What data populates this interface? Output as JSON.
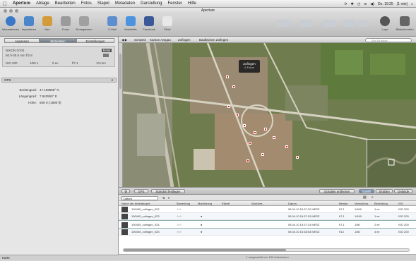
{
  "menubar": {
    "items": [
      "Aperture",
      "Ablage",
      "Bearbeiten",
      "Fotos",
      "Stapel",
      "Metadaten",
      "Darstellung",
      "Fenster",
      "Hilfe"
    ],
    "clock": "Do. 19:25",
    "extra": "(1 min)"
  },
  "window": {
    "title": "Aperture"
  },
  "toolbar": {
    "left": [
      {
        "label": "Informationen",
        "icon": "info-icon",
        "color": "#3a78c8"
      },
      {
        "label": "Importieren",
        "icon": "import-icon",
        "color": "#4a86c9"
      },
      {
        "label": "Neu",
        "icon": "new-icon",
        "color": "#d49b3a"
      },
      {
        "label": "Fotos",
        "icon": "photos-icon",
        "color": "#9b9b9b"
      },
      {
        "label": "Ermegebnen",
        "icon": "share-icon",
        "color": "#a0a0a0"
      },
      {
        "label": "E-Mail",
        "icon": "mail-icon",
        "color": "#5d8fd0"
      },
      {
        "label": "MobileMe",
        "icon": "cloud-icon",
        "color": "#4b93df"
      },
      {
        "label": "Facebook",
        "icon": "facebook-icon",
        "color": "#3b5998"
      },
      {
        "label": "Flickr",
        "icon": "flickr-icon",
        "color": "#e8e8e8"
      }
    ],
    "right": [
      {
        "label": "Lupe",
        "icon": "loupe-icon"
      },
      {
        "label": "Bildschirmfoto",
        "icon": "fullscreen-icon"
      }
    ]
  },
  "left_panel": {
    "tabs": [
      "Anpassen",
      "Metadaten",
      "Einstellungen"
    ],
    "camera": {
      "model": "NIKON D700",
      "lens": "50.0-35.0 mm f/2.8",
      "raw_badge": "RAW",
      "iso": "ISO 200",
      "shutter": "1/60 s",
      "exposure": "0 ev",
      "aperture": "f/7.1",
      "focal": "13 mm"
    },
    "section": "GPS",
    "gps": [
      {
        "label": "Breitengrad:",
        "value": "47.169888° N"
      },
      {
        "label": "Längengrad:",
        "value": "7.943550° E"
      },
      {
        "label": "Höhe:",
        "value": "508 m (1890 ft)"
      }
    ],
    "bottom_label": "Karte"
  },
  "breadcrumbs": [
    "Schweiz",
    "Kanton Aargau",
    "Zofingen",
    "Bauflächen Zofingen"
  ],
  "search": {
    "placeholder": "Alle Einträge"
  },
  "map": {
    "tooltip_title": "Zofingen",
    "tooltip_sub": "6 Fotos"
  },
  "strip": {
    "left_buttons": [
      "GPS",
      "Standort festlegen"
    ],
    "right_buttons": [
      "Schatten entfernen",
      "Satellit",
      "Straßen",
      "Gelände"
    ],
    "active": "Satellit"
  },
  "list": {
    "filter": "Datum",
    "columns": [
      "Name der Arbeitskopie",
      "Bewertung",
      "Markierung",
      "Etikett",
      "Worüber...",
      "Datum",
      "Blende",
      "Verschluss",
      "Belichtung",
      "ISO"
    ],
    "rows": [
      {
        "name": "100405_zofingen_022",
        "rating": "☆☆",
        "flag": "",
        "date": "05.04.10 15:37:12 MESZ",
        "aperture": "f/7.1",
        "shutter": "1/400",
        "exposure": "1 ev",
        "iso": "ISO 200"
      },
      {
        "name": "100405_zofingen_023",
        "rating": "☆☆",
        "flag": "●",
        "date": "05.04.10 15:37:13 MESZ",
        "aperture": "f/7.1",
        "shutter": "1/160",
        "exposure": "1 ev",
        "iso": "ISO 200"
      },
      {
        "name": "100405_zofingen_024",
        "rating": "☆☆",
        "flag": "●",
        "date": "05.04.10 15:37:13 MESZ",
        "aperture": "f/7.1",
        "shutter": "1/80",
        "exposure": "2 ev",
        "iso": "ISO 200"
      },
      {
        "name": "100405_zofingen_025",
        "rating": "☆☆",
        "flag": "●",
        "date": "05.04.10 15:38:53 MESZ",
        "aperture": "f/13",
        "shutter": "1/60",
        "exposure": "4 ev",
        "iso": "ISO 200"
      }
    ],
    "status": "1 ausgewählt von 160 Aufnahmen"
  },
  "colors": {
    "accent": "#5b7a9e",
    "pin": "#e02020"
  }
}
